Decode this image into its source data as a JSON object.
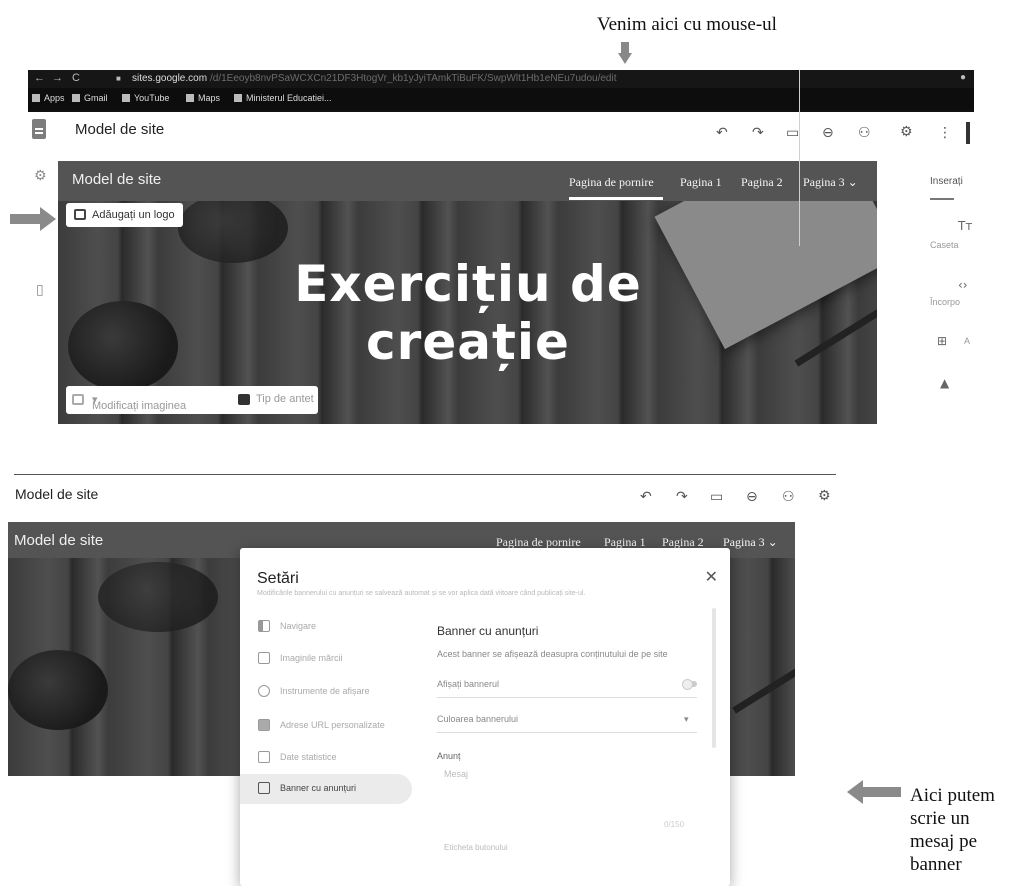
{
  "annotations": {
    "top": "Venim aici cu mouse-ul",
    "bottom_lines": [
      "Aici putem",
      "scrie un",
      "mesaj pe",
      "banner"
    ]
  },
  "browser": {
    "url_domain": "sites.google.com",
    "url_path": "/d/1Eeoyb8nvPSaWCXCn21DF3HtogVr_kb1yJyiTAmkTiBuFK/SwpWlt1Hb1eNEu7udou/edit",
    "bookmarks": [
      "Apps",
      "Gmail",
      "YouTube",
      "Maps",
      "Ministerul Educatiei..."
    ]
  },
  "editor": {
    "doc_title": "Model de site"
  },
  "site": {
    "title": "Model de site",
    "nav": [
      "Pagina de pornire",
      "Pagina 1",
      "Pagina 2",
      "Pagina 3"
    ],
    "hero_line1": "Exercițiu de",
    "hero_line2": "creație",
    "add_logo": "Adăugați un logo",
    "change_image": "Modificați imaginea",
    "header_type": "Tip de antet"
  },
  "insert_panel": {
    "tab": "Inserați",
    "items": [
      "Caseta",
      "Încorpo",
      "A"
    ]
  },
  "settings": {
    "title": "Setări",
    "subtitle": "Modificările bannerului cu anunțuri se salvează automat și se vor aplica dată viitoare când publicați site-ul.",
    "menu": [
      "Navigare",
      "Imaginile mărcii",
      "Instrumente de afișare",
      "Adrese URL personalizate",
      "Date statistice",
      "Banner cu anunțuri"
    ],
    "pane": {
      "heading": "Banner cu anunțuri",
      "description": "Acest banner se afișează deasupra conținutului de pe site",
      "show_banner": "Afișați bannerul",
      "banner_color": "Culoarea bannerului",
      "announcement": "Anunț",
      "message": "Mesaj",
      "counter": "0/150",
      "button_label": "Eticheta butonului"
    }
  }
}
